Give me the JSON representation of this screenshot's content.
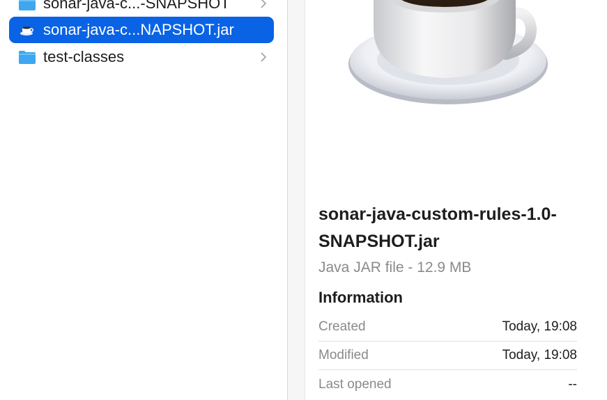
{
  "sidebar": {
    "items": [
      {
        "label": "sonar-java-c...-SNAPSHOT",
        "icon": "folder-icon",
        "has_chevron": true,
        "selected": false
      },
      {
        "label": "sonar-java-c...NAPSHOT.jar",
        "icon": "java-cup-icon",
        "has_chevron": false,
        "selected": true
      },
      {
        "label": "test-classes",
        "icon": "folder-icon",
        "has_chevron": true,
        "selected": false
      }
    ]
  },
  "preview": {
    "icon": "java-coffee-cup-icon",
    "file_name": "sonar-java-custom-rules-1.0-SNAPSHOT.jar",
    "file_kind": "Java JAR file - 12.9 MB",
    "info_heading": "Information",
    "info_rows": [
      {
        "key": "Created",
        "value": "Today, 19:08"
      },
      {
        "key": "Modified",
        "value": "Today, 19:08"
      },
      {
        "key": "Last opened",
        "value": "--"
      }
    ]
  },
  "colors": {
    "selection": "#0a63e5",
    "folder": "#3ea7f0",
    "secondary_text": "#8a8a8e"
  }
}
